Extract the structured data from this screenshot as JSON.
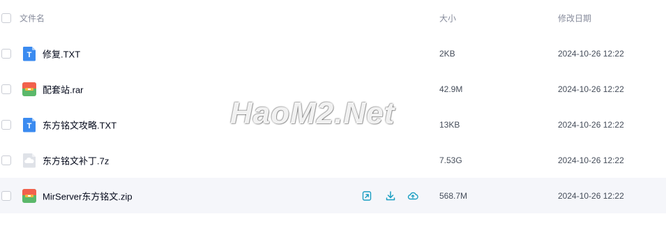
{
  "header": {
    "col_name": "文件名",
    "col_size": "大小",
    "col_date": "修改日期"
  },
  "files": [
    {
      "name": "修复.TXT",
      "size": "2KB",
      "date": "2024-10-26 12:22",
      "icon": "txt-file-icon"
    },
    {
      "name": "配套站.rar",
      "size": "42.9M",
      "date": "2024-10-26 12:22",
      "icon": "archive-file-icon"
    },
    {
      "name": "东方铭文攻略.TXT",
      "size": "13KB",
      "date": "2024-10-26 12:22",
      "icon": "txt-file-icon"
    },
    {
      "name": "东方铭文补丁.7z",
      "size": "7.53G",
      "date": "2024-10-26 12:22",
      "icon": "unknown-file-icon"
    },
    {
      "name": "MirServer东方铭文.zip",
      "size": "568.7M",
      "date": "2024-10-26 12:22",
      "icon": "archive-file-icon"
    }
  ],
  "row_actions": [
    "share-icon",
    "download-icon",
    "cloud-upload-icon"
  ],
  "watermark": "HaoM2.Net",
  "colors": {
    "txt_icon": "#3b8bf0",
    "archive_icon_top": "#f2604c",
    "archive_icon_bottom": "#5bb86a",
    "archive_icon_mid": "#f4b83e",
    "action_icon": "#1a9ec2",
    "hover_row": "#f5f6fa"
  }
}
